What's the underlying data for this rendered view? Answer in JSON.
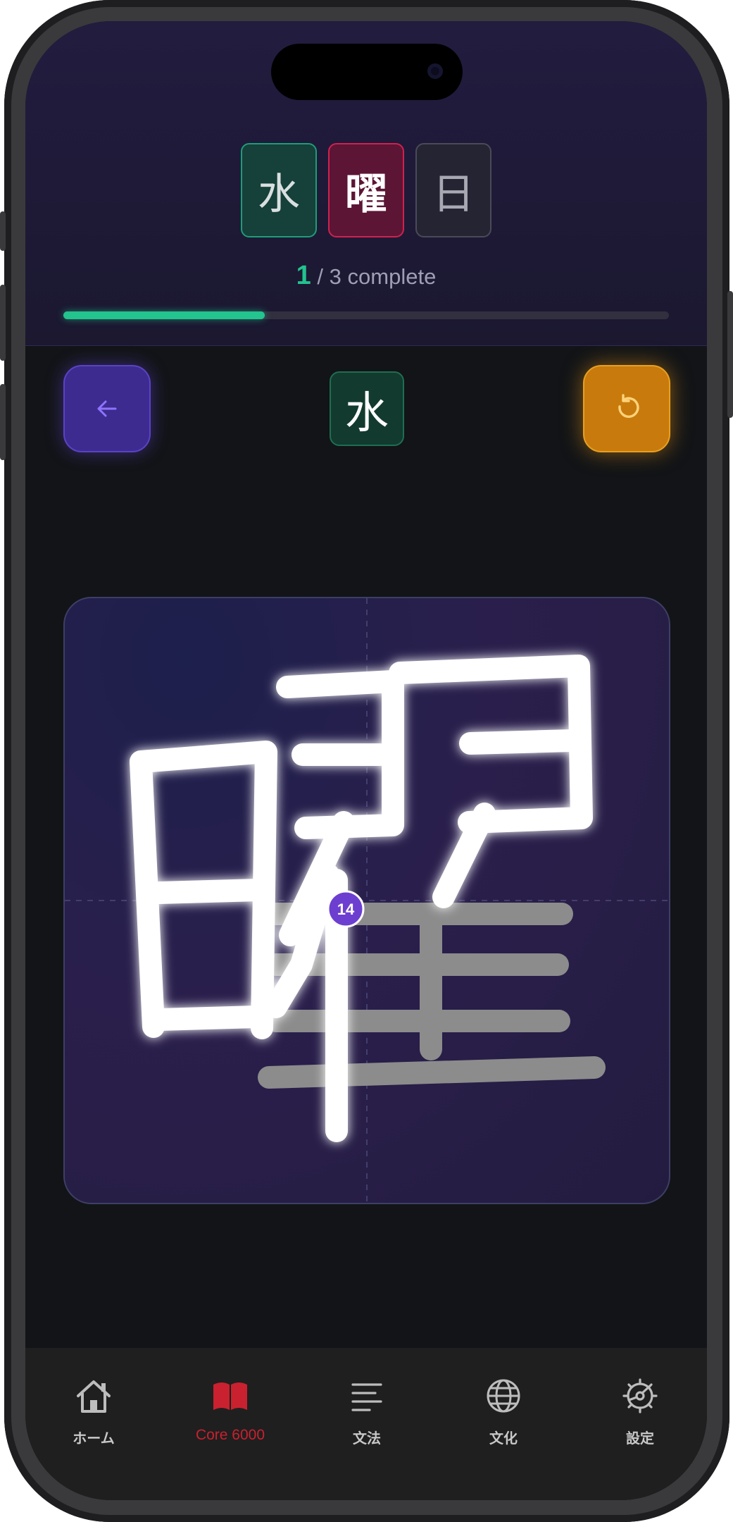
{
  "kanji_sequence": [
    {
      "char": "水",
      "state": "done"
    },
    {
      "char": "曜",
      "state": "active"
    },
    {
      "char": "日",
      "state": "pending"
    }
  ],
  "progress": {
    "completed": "1",
    "separator": "/",
    "total": "3",
    "suffix": "complete",
    "fraction": 0.333
  },
  "controls": {
    "back_icon": "arrow-left-icon",
    "reset_icon": "rotate-ccw-icon",
    "previous_kanji": "水"
  },
  "canvas": {
    "target_kanji": "曜",
    "stroke_number_badge": "14"
  },
  "tabs": [
    {
      "label": "ホーム",
      "icon": "home-icon",
      "active": false
    },
    {
      "label": "Core 6000",
      "icon": "book-icon",
      "active": true
    },
    {
      "label": "文法",
      "icon": "text-lines-icon",
      "active": false
    },
    {
      "label": "文化",
      "icon": "globe-icon",
      "active": false
    },
    {
      "label": "設定",
      "icon": "gear-icon",
      "active": false
    }
  ],
  "colors": {
    "accent_green": "#23c48d",
    "accent_red": "#c9212f",
    "accent_purple": "#5b43c4",
    "accent_orange": "#e8a021"
  }
}
